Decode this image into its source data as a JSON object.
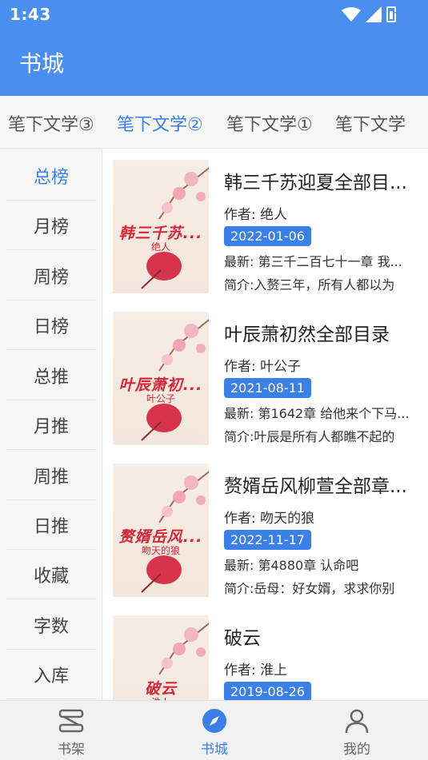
{
  "status": {
    "time": "1:43"
  },
  "app": {
    "title": "书城"
  },
  "source_tabs": [
    {
      "label": "笔下文学③",
      "active": false
    },
    {
      "label": "笔下文学②",
      "active": true
    },
    {
      "label": "笔下文学①",
      "active": false
    },
    {
      "label": "笔下文学",
      "active": false
    }
  ],
  "categories": [
    {
      "label": "总榜",
      "active": true
    },
    {
      "label": "月榜"
    },
    {
      "label": "周榜"
    },
    {
      "label": "日榜"
    },
    {
      "label": "总推"
    },
    {
      "label": "月推"
    },
    {
      "label": "周推"
    },
    {
      "label": "日推"
    },
    {
      "label": "收藏"
    },
    {
      "label": "字数"
    },
    {
      "label": "入库"
    }
  ],
  "books": [
    {
      "title": "韩三千苏迎夏全部目...",
      "cover_title": "韩三千苏...",
      "cover_author": "绝人",
      "author": "作者: 绝人",
      "date": "2022-01-06",
      "latest": "最新: 第三千二百七十一章 我...",
      "intro": "简介:入赘三年，所有人都以为"
    },
    {
      "title": "叶辰萧初然全部目录",
      "cover_title": "叶辰萧初...",
      "cover_author": "叶公子",
      "author": "作者: 叶公子",
      "date": "2021-08-11",
      "latest": "最新: 第1642章 给他来个下马...",
      "intro": "简介:叶辰是所有人都瞧不起的"
    },
    {
      "title": "赘婿岳风柳萱全部章...",
      "cover_title": "赘婿岳风...",
      "cover_author": "吻天的狼",
      "author": "作者: 吻天的狼",
      "date": "2022-11-17",
      "latest": "最新: 第4880章 认命吧",
      "intro": "简介:岳母：好女婿，求求你别"
    },
    {
      "title": "破云",
      "cover_title": "破云",
      "cover_author": "淮上",
      "author": "作者: 淮上",
      "date": "2019-08-26",
      "latest": "",
      "intro": ""
    }
  ],
  "bottom_nav": [
    {
      "label": "书架",
      "icon": "bookshelf-icon",
      "active": false
    },
    {
      "label": "书城",
      "icon": "compass-icon",
      "active": true
    },
    {
      "label": "我的",
      "icon": "person-icon",
      "active": false
    }
  ],
  "colors": {
    "accent": "#3b7fe8",
    "appbar": "#4a8ef0",
    "cover_title": "#d42638"
  }
}
